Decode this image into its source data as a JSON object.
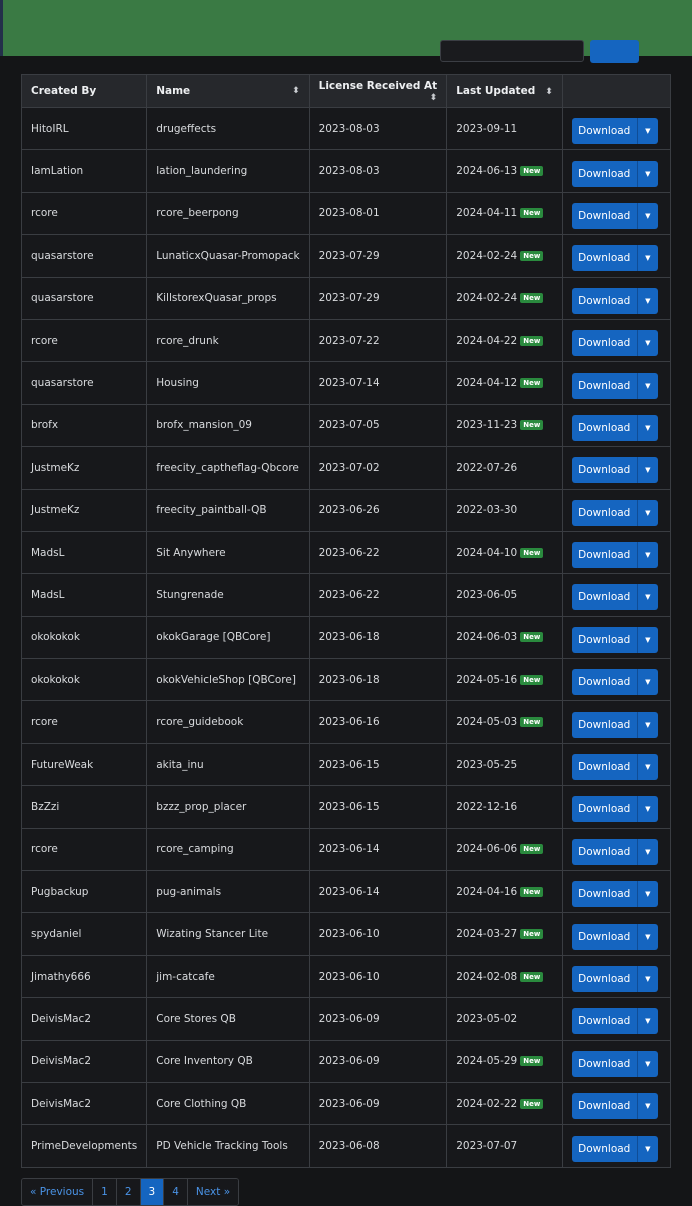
{
  "table": {
    "headers": [
      "Created By",
      "Name",
      "License Received At",
      "Last Updated",
      ""
    ],
    "download_label": "Download",
    "new_label": "New",
    "rows": [
      {
        "creator": "HitoIRL",
        "name": "drugeffects",
        "received": "2023-08-03",
        "updated": "2023-09-11",
        "is_new": false
      },
      {
        "creator": "IamLation",
        "name": "lation_laundering",
        "received": "2023-08-03",
        "updated": "2024-06-13",
        "is_new": true
      },
      {
        "creator": "rcore",
        "name": "rcore_beerpong",
        "received": "2023-08-01",
        "updated": "2024-04-11",
        "is_new": true
      },
      {
        "creator": "quasarstore",
        "name": "LunaticxQuasar-Promopack",
        "received": "2023-07-29",
        "updated": "2024-02-24",
        "is_new": true
      },
      {
        "creator": "quasarstore",
        "name": "KillstorexQuasar_props",
        "received": "2023-07-29",
        "updated": "2024-02-24",
        "is_new": true
      },
      {
        "creator": "rcore",
        "name": "rcore_drunk",
        "received": "2023-07-22",
        "updated": "2024-04-22",
        "is_new": true
      },
      {
        "creator": "quasarstore",
        "name": "Housing",
        "received": "2023-07-14",
        "updated": "2024-04-12",
        "is_new": true
      },
      {
        "creator": "brofx",
        "name": "brofx_mansion_09",
        "received": "2023-07-05",
        "updated": "2023-11-23",
        "is_new": true
      },
      {
        "creator": "JustmeKz",
        "name": "freecity_captheflag-Qbcore",
        "received": "2023-07-02",
        "updated": "2022-07-26",
        "is_new": false
      },
      {
        "creator": "JustmeKz",
        "name": "freecity_paintball-QB",
        "received": "2023-06-26",
        "updated": "2022-03-30",
        "is_new": false
      },
      {
        "creator": "MadsL",
        "name": "Sit Anywhere",
        "received": "2023-06-22",
        "updated": "2024-04-10",
        "is_new": true
      },
      {
        "creator": "MadsL",
        "name": "Stungrenade",
        "received": "2023-06-22",
        "updated": "2023-06-05",
        "is_new": false
      },
      {
        "creator": "okokokok",
        "name": "okokGarage [QBCore]",
        "received": "2023-06-18",
        "updated": "2024-06-03",
        "is_new": true
      },
      {
        "creator": "okokokok",
        "name": "okokVehicleShop [QBCore]",
        "received": "2023-06-18",
        "updated": "2024-05-16",
        "is_new": true
      },
      {
        "creator": "rcore",
        "name": "rcore_guidebook",
        "received": "2023-06-16",
        "updated": "2024-05-03",
        "is_new": true
      },
      {
        "creator": "FutureWeak",
        "name": "akita_inu",
        "received": "2023-06-15",
        "updated": "2023-05-25",
        "is_new": false
      },
      {
        "creator": "BzZzi",
        "name": "bzzz_prop_placer",
        "received": "2023-06-15",
        "updated": "2022-12-16",
        "is_new": false
      },
      {
        "creator": "rcore",
        "name": "rcore_camping",
        "received": "2023-06-14",
        "updated": "2024-06-06",
        "is_new": true
      },
      {
        "creator": "Pugbackup",
        "name": "pug-animals",
        "received": "2023-06-14",
        "updated": "2024-04-16",
        "is_new": true
      },
      {
        "creator": "spydaniel",
        "name": "Wizating Stancer Lite",
        "received": "2023-06-10",
        "updated": "2024-03-27",
        "is_new": true
      },
      {
        "creator": "Jimathy666",
        "name": "jim-catcafe",
        "received": "2023-06-10",
        "updated": "2024-02-08",
        "is_new": true
      },
      {
        "creator": "DeivisMac2",
        "name": "Core Stores QB",
        "received": "2023-06-09",
        "updated": "2023-05-02",
        "is_new": false
      },
      {
        "creator": "DeivisMac2",
        "name": "Core Inventory QB",
        "received": "2023-06-09",
        "updated": "2024-05-29",
        "is_new": true
      },
      {
        "creator": "DeivisMac2",
        "name": "Core Clothing QB",
        "received": "2023-06-09",
        "updated": "2024-02-22",
        "is_new": true
      },
      {
        "creator": "PrimeDevelopments",
        "name": "PD Vehicle Tracking Tools",
        "received": "2023-06-08",
        "updated": "2023-07-07",
        "is_new": false
      }
    ]
  },
  "pagination": {
    "previous_label": "« Previous",
    "pages": [
      "1",
      "2",
      "3",
      "4"
    ],
    "current": "3",
    "next_label": "Next »"
  },
  "colors": {
    "topbar": "#3a7a44",
    "primary": "#1565c0",
    "new_badge": "#2a8a3e"
  }
}
